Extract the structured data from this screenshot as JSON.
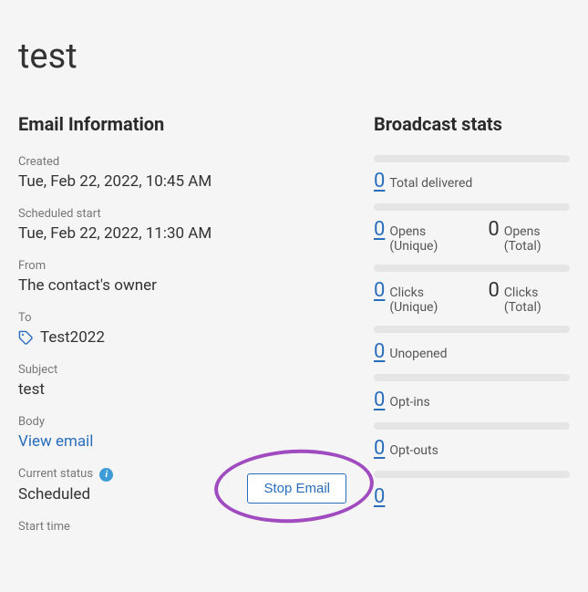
{
  "page": {
    "title": "test"
  },
  "email_info": {
    "heading": "Email Information",
    "created_label": "Created",
    "created_value": "Tue, Feb 22, 2022, 10:45 AM",
    "scheduled_label": "Scheduled start",
    "scheduled_value": "Tue, Feb 22, 2022, 11:30 AM",
    "from_label": "From",
    "from_value": "The contact's owner",
    "to_label": "To",
    "to_value": "Test2022",
    "subject_label": "Subject",
    "subject_value": "test",
    "body_label": "Body",
    "body_link": "View email",
    "status_label": "Current status",
    "status_value": "Scheduled",
    "stop_button": "Stop Email",
    "start_time_label": "Start time"
  },
  "stats": {
    "heading": "Broadcast stats",
    "items": [
      {
        "bar": true,
        "values": [
          {
            "val": "0",
            "label": "Total delivered",
            "link": true
          }
        ]
      },
      {
        "bar": true,
        "values": [
          {
            "val": "0",
            "label": "Opens (Unique)",
            "link": true
          },
          {
            "val": "0",
            "label": "Opens (Total)",
            "link": false
          }
        ]
      },
      {
        "bar": true,
        "values": [
          {
            "val": "0",
            "label": "Clicks (Unique)",
            "link": true
          },
          {
            "val": "0",
            "label": "Clicks (Total)",
            "link": false
          }
        ]
      },
      {
        "bar": true,
        "values": [
          {
            "val": "0",
            "label": "Unopened",
            "link": true
          }
        ]
      },
      {
        "bar": true,
        "values": [
          {
            "val": "0",
            "label": "Opt-ins",
            "link": true
          }
        ]
      },
      {
        "bar": true,
        "values": [
          {
            "val": "0",
            "label": "Opt-outs",
            "link": true
          }
        ]
      },
      {
        "bar": true,
        "values": [
          {
            "val": "0",
            "label": "",
            "link": true
          }
        ]
      }
    ]
  }
}
